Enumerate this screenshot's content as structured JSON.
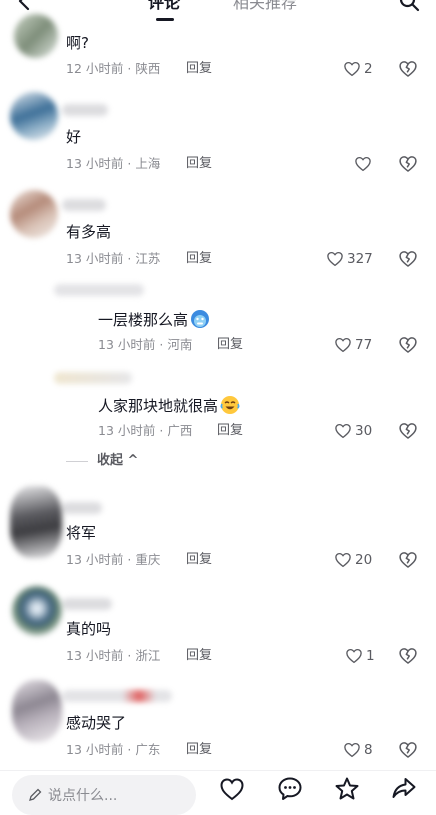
{
  "tabs": {
    "comments": "评论",
    "related": "相关推荐"
  },
  "comments": [
    {
      "text": "啊?",
      "time": "12 小时前",
      "location": "陕西",
      "likes": "2"
    },
    {
      "text": "好",
      "time": "13 小时前",
      "location": "上海",
      "likes": ""
    },
    {
      "text": "有多高",
      "time": "13 小时前",
      "location": "江苏",
      "likes": "327"
    },
    {
      "text": "一层楼那么高",
      "time": "13 小时前",
      "location": "河南",
      "likes": "77"
    },
    {
      "text": "人家那块地就很高",
      "time": "13 小时前",
      "location": "广西",
      "likes": "30"
    },
    {
      "text": "将军",
      "time": "13 小时前",
      "location": "重庆",
      "likes": "20"
    },
    {
      "text": "真的吗",
      "time": "13 小时前",
      "location": "浙江",
      "likes": "1"
    },
    {
      "text": "感动哭了",
      "time": "13 小时前",
      "location": "广东",
      "likes": "8"
    }
  ],
  "reply_label": "回复",
  "meta_separator": "·",
  "collapse_label": "收起 ^",
  "input": {
    "placeholder": "说点什么..."
  },
  "colors": {
    "text": "#161823",
    "meta": "#8a8b91",
    "background": "#ffffff"
  },
  "icons": [
    "back-icon",
    "search-icon",
    "heart-icon",
    "dislike-icon",
    "comment-icon",
    "star-icon",
    "share-icon",
    "pencil-icon"
  ]
}
